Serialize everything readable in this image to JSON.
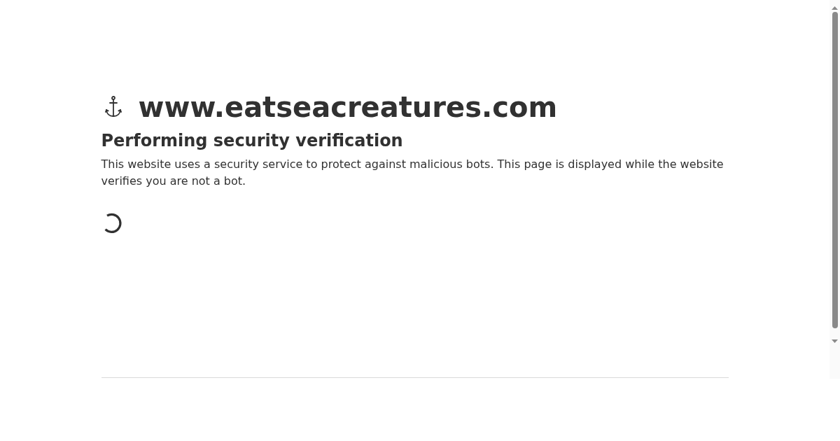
{
  "site": {
    "domain": "www.eatseacreatures.com"
  },
  "heading": "Performing security verification",
  "message": "This website uses a security service to protect against malicious bots. This page is displayed while the website verifies you are not a bot."
}
